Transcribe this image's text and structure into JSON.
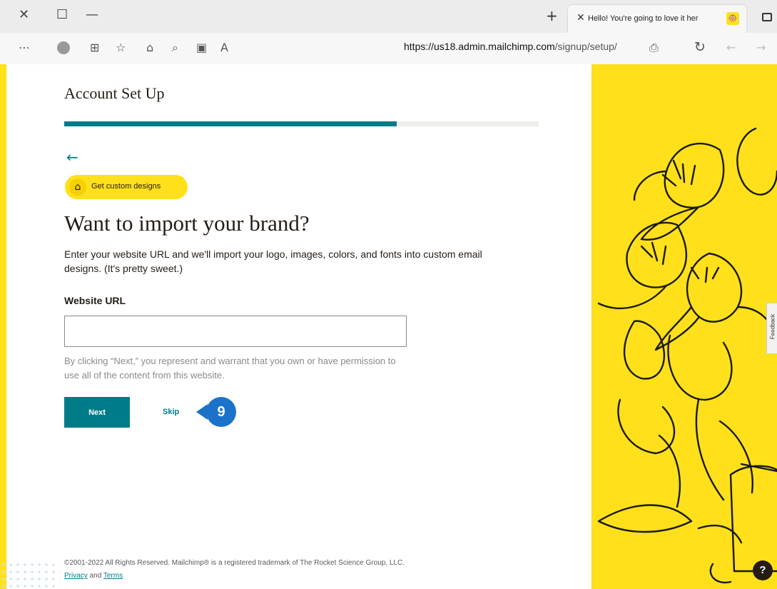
{
  "browser": {
    "window_controls": {
      "close": "✕",
      "maximize": "☐",
      "minimize": "—"
    },
    "new_tab": "+",
    "tab": {
      "close": "✕",
      "title": "Hello! You're going to love it her",
      "favicon": "🐵"
    },
    "toolbar_icons": [
      "more-icon",
      "profile-icon",
      "collections-icon",
      "favorites-icon",
      "extensions-icon",
      "zoom-icon",
      "immersive-reader-icon",
      "read-aloud-icon"
    ],
    "url": {
      "host": "https://us18.admin.mailchimp.com",
      "path": "/signup/setup/"
    },
    "nav": {
      "refresh": "↻",
      "back": "←",
      "forward": "→"
    }
  },
  "page": {
    "title": "Account Set Up",
    "progress": 0.7,
    "back_arrow": "←",
    "badge": "Get custom designs",
    "heading": "Want to import your brand?",
    "description": "Enter your website URL and we'll import your logo, images, colors, and fonts into custom email designs. (It's pretty sweet.)",
    "field_label": "Website URL",
    "field_value": "",
    "disclaimer": "By clicking “Next,” you represent and warrant that you own or have permission to use all of the content from this website.",
    "next_label": "Next",
    "skip_label": "Skip",
    "step_number": "9",
    "footer": "©2001-2022 All Rights Reserved. Mailchimp® is a registered trademark of The Rocket Science Group, LLC.",
    "privacy": "Privacy",
    "and": "and",
    "terms": "Terms",
    "feedback": "Feedback",
    "help": "?"
  },
  "colors": {
    "accent": "#007c89",
    "brand_yellow": "#ffe01b",
    "text": "#241c15",
    "step_marker": "#1a73c8"
  }
}
